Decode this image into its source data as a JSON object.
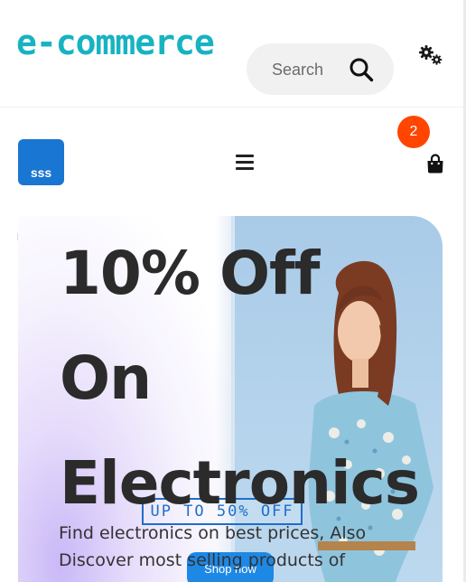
{
  "header": {
    "logo_text": "e-commerce",
    "search": {
      "placeholder": "Search"
    },
    "icons": {
      "search": "search-icon",
      "settings": "gear-icon"
    }
  },
  "navbar": {
    "brand_badge": "sss",
    "cart_count": "2",
    "icons": {
      "menu": "hamburger-menu-icon",
      "cart": "shopping-bag-icon"
    },
    "colors": {
      "brand": "#1976d2",
      "cart_badge": "#ff4500"
    }
  },
  "hero": {
    "title_lines": [
      "10% Off",
      "On",
      "Electronics"
    ],
    "description": "Find electronics on best prices, Also Discover most selling products of",
    "banner_promo": "UP TO 50% OFF",
    "banner_button": "Shop now"
  },
  "theme": {
    "logo_color": "#17b3c1",
    "accent": "#1e6fc9"
  }
}
